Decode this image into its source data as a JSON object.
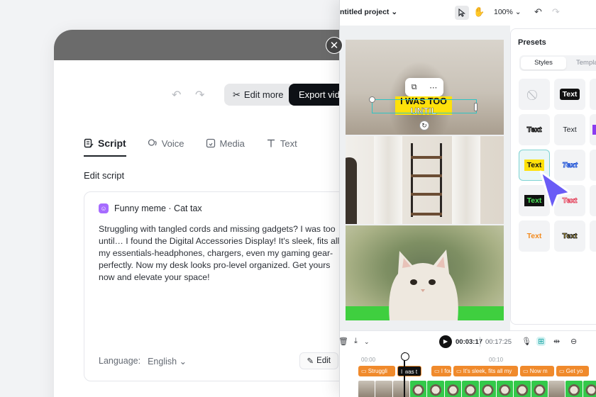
{
  "script_window": {
    "close_icon": "close-icon",
    "edit_more_label": "Edit more",
    "export_label": "Export video",
    "tabs": [
      {
        "label": "Script",
        "icon": "script-icon"
      },
      {
        "label": "Voice",
        "icon": "voice-icon"
      },
      {
        "label": "Media",
        "icon": "media-icon"
      },
      {
        "label": "Text",
        "icon": "text-icon"
      }
    ],
    "edit_script_heading": "Edit script",
    "card": {
      "title": "Funny meme · Cat tax",
      "body": "Struggling with tangled cords and missing gadgets? I was too until… I found the Digital Accessories Display! It's sleek, fits all my essentials-headphones, chargers, even my gaming gear-perfectly. Now my desk looks pro-level organized. Get yours now and elevate your space!",
      "language_label": "Language:",
      "language_value": "English",
      "edit_label": "Edit"
    }
  },
  "editor": {
    "project_title": "ntitled project",
    "zoom": "100%",
    "caption_line1": "I WAS TOO",
    "caption_line2": "UNTIL",
    "presets": {
      "title": "Presets",
      "tab_styles": "Styles",
      "tab_templates": "Templa",
      "cells": [
        "",
        "Text",
        "",
        "Text",
        "Text",
        "",
        "Text",
        "Text",
        "",
        "Text",
        "Text",
        "",
        "Text",
        "Text",
        ""
      ]
    },
    "timeline": {
      "current_time": "00:03:17",
      "total_time": "00:17:25",
      "ruler": [
        "00:00",
        "00:10"
      ],
      "clips": [
        "Struggli",
        "I was t",
        "I four",
        "It's sleek, fits all my",
        "Now m",
        "Get yo"
      ]
    }
  },
  "colors": {
    "caption_yellow": "#ffe10a",
    "selection_teal": "#2ec4c4",
    "clip_orange": "#f08a2c",
    "cursor_purple": "#6a5cf6"
  }
}
